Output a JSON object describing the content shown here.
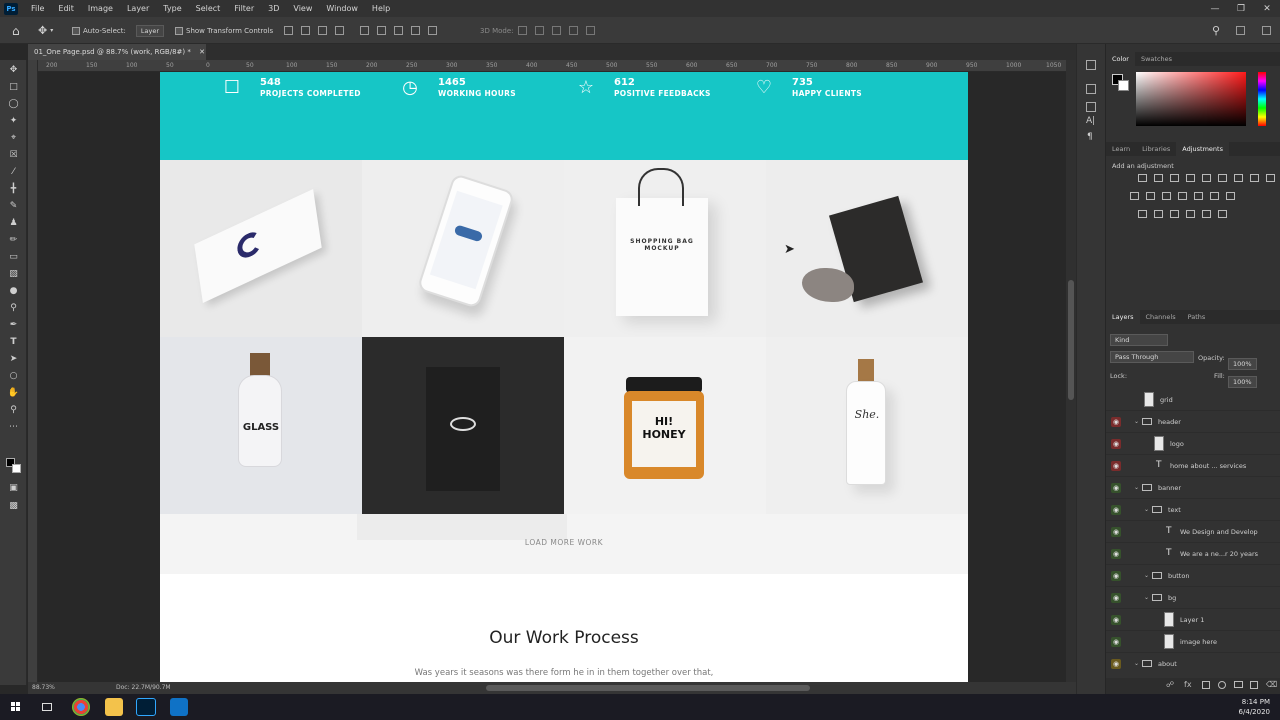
{
  "app": {
    "logo_text": "Ps"
  },
  "menubar": {
    "items": [
      "File",
      "Edit",
      "Image",
      "Layer",
      "Type",
      "Select",
      "Filter",
      "3D",
      "View",
      "Window",
      "Help"
    ]
  },
  "window_controls": [
    "—",
    "❐",
    "✕"
  ],
  "options_bar": {
    "auto_select_label": "Auto-Select:",
    "auto_select_target": "Layer",
    "transform_label": "Show Transform Controls",
    "mode_3d_label": "3D Mode:"
  },
  "document": {
    "tab_label": "01_One Page.psd @ 88.7% (work, RGB/8#) *",
    "zoom": "88.73%",
    "doc_info": "Doc: 22.7M/90.7M"
  },
  "ruler": {
    "labels": [
      "200",
      "150",
      "100",
      "50",
      "0",
      "50",
      "100",
      "150",
      "200",
      "250",
      "300",
      "350",
      "400",
      "450",
      "500",
      "550",
      "600",
      "650",
      "700",
      "750",
      "800",
      "850",
      "900",
      "950",
      "1000",
      "1050"
    ]
  },
  "canvas": {
    "stats": [
      {
        "icon": "briefcase-icon",
        "glyph": "☐",
        "number": "548",
        "label": "PROJECTS COMPLETED"
      },
      {
        "icon": "clock-icon",
        "glyph": "◷",
        "number": "1465",
        "label": "WORKING HOURS"
      },
      {
        "icon": "star-icon",
        "glyph": "☆",
        "number": "612",
        "label": "POSITIVE FEEDBACKS"
      },
      {
        "icon": "heart-icon",
        "glyph": "♡",
        "number": "735",
        "label": "HAPPY CLIENTS"
      }
    ],
    "gallery": {
      "bag_text": "SHOPPING BAG MOCKUP",
      "glass_text": "GLASS",
      "honey_text": "HI! HONEY",
      "bottle_text": "She."
    },
    "load_more": "LOAD MORE WORK",
    "process_title": "Our Work Process",
    "process_subtitle": "Was years it seasons was there form he in in them together over that,"
  },
  "panels": {
    "color_tabs": [
      "Color",
      "Swatches"
    ],
    "adjust_tabs": [
      "Learn",
      "Libraries",
      "Adjustments"
    ],
    "add_adjustment": "Add an adjustment",
    "layers_tabs": [
      "Layers",
      "Channels",
      "Paths"
    ],
    "filter_kind": "Kind",
    "blend_mode": "Pass Through",
    "opacity_label": "Opacity:",
    "opacity_value": "100%",
    "lock_label": "Lock:",
    "fill_label": "Fill:",
    "fill_value": "100%",
    "layers": [
      {
        "name": "grid",
        "type": "thumb",
        "indent": 0,
        "color": "none"
      },
      {
        "name": "header",
        "type": "group",
        "indent": 0,
        "color": "red"
      },
      {
        "name": "logo",
        "type": "thumb",
        "indent": 1,
        "color": "red"
      },
      {
        "name": "home     about  ...  services",
        "type": "text",
        "indent": 1,
        "color": "red"
      },
      {
        "name": "banner",
        "type": "group",
        "indent": 0,
        "color": "green"
      },
      {
        "name": "text",
        "type": "group",
        "indent": 1,
        "color": "green"
      },
      {
        "name": "We Design and Develop",
        "type": "text",
        "indent": 2,
        "color": "green"
      },
      {
        "name": "We are a ne...r 20 years",
        "type": "text",
        "indent": 2,
        "color": "green"
      },
      {
        "name": "button",
        "type": "group",
        "indent": 1,
        "color": "green"
      },
      {
        "name": "bg",
        "type": "group",
        "indent": 1,
        "color": "green"
      },
      {
        "name": "Layer 1",
        "type": "thumb",
        "indent": 2,
        "color": "green"
      },
      {
        "name": "image here",
        "type": "thumb",
        "indent": 2,
        "color": "green"
      },
      {
        "name": "about",
        "type": "group",
        "indent": 0,
        "color": "yellow"
      }
    ]
  },
  "taskbar": {
    "time": "8:14 PM",
    "date": "6/4/2020"
  }
}
